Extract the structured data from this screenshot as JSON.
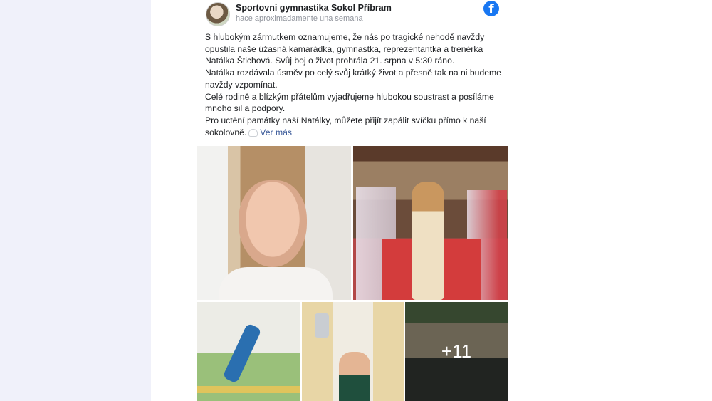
{
  "post": {
    "page_name": "Sportovni gymnastika Sokol Příbram",
    "timestamp": "hace aproximadamente una semana",
    "fb_icon": "f",
    "paragraphs": [
      "S hlubokým zármutkem oznamujeme, že nás po tragické nehodě navždy opustila naše úžasná kamarádka, gymnastka, reprezentantka a trenérka Natálka Štichová. Svůj boj o život prohrála 21. srpna v 5:30 ráno.",
      "Natálka rozdávala úsměv po celý svůj krátký život a přesně tak na ni budeme navždy vzpomínat.",
      "Celé rodině a blízkým přátelům vyjadřujeme hlubokou soustrast a posíláme mnoho sil a podpory.",
      "Pro uctění památky naší Natálky, můžete přijít zapálit svíčku přímo k naší sokolovně."
    ],
    "see_more": "Ver más",
    "more_photos": "+11"
  },
  "icons": [
    "facebook-icon",
    "heart-icon"
  ],
  "colors": {
    "facebook_blue": "#1877f2",
    "link": "#385898",
    "left_band": "#f0f1fa"
  }
}
